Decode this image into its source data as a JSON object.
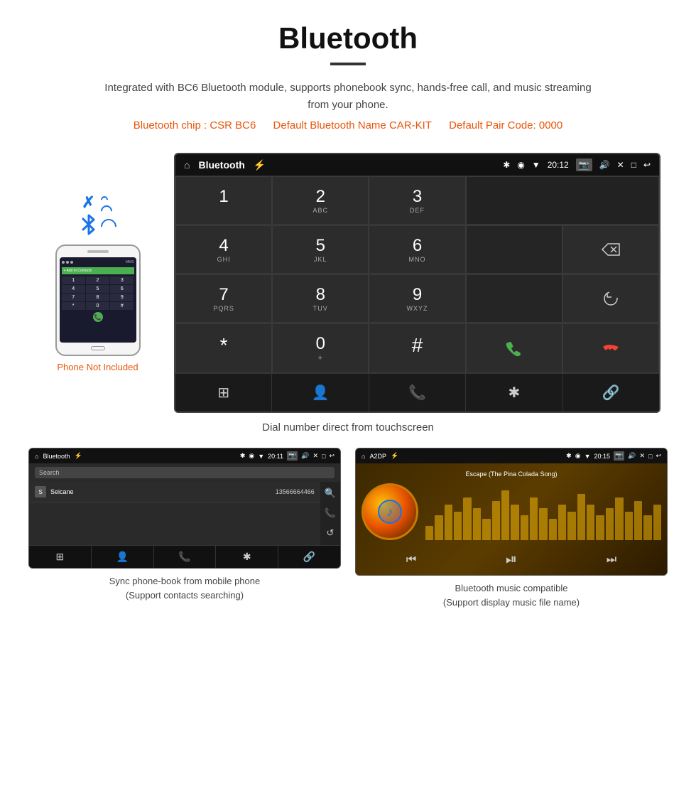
{
  "page": {
    "title": "Bluetooth",
    "subtitle": "Integrated with BC6 Bluetooth module, supports phonebook sync, hands-free call, and music streaming from your phone.",
    "spec_chip": "Bluetooth chip : CSR BC6",
    "spec_name": "Default Bluetooth Name CAR-KIT",
    "spec_code": "Default Pair Code: 0000",
    "phone_not_included": "Phone Not Included",
    "caption_main": "Dial number direct from touchscreen",
    "caption_phonebook": "Sync phone-book from mobile phone\n(Support contacts searching)",
    "caption_music": "Bluetooth music compatible\n(Support display music file name)"
  },
  "car_screen": {
    "status": {
      "home_icon": "⌂",
      "title": "Bluetooth",
      "usb_icon": "⚡",
      "bluetooth_icon": "✱",
      "location_icon": "●",
      "signal_icon": "▼",
      "time": "20:12",
      "camera_icon": "📷",
      "volume_icon": "🔊",
      "close_icon": "✕",
      "window_icon": "□",
      "back_icon": "↩"
    },
    "dialpad": {
      "keys": [
        {
          "main": "1",
          "sub": ""
        },
        {
          "main": "2",
          "sub": "ABC"
        },
        {
          "main": "3",
          "sub": "DEF"
        },
        {
          "main": "",
          "sub": "",
          "type": "display",
          "span": 2
        },
        {
          "main": "4",
          "sub": "GHI"
        },
        {
          "main": "5",
          "sub": "JKL"
        },
        {
          "main": "6",
          "sub": "MNO"
        },
        {
          "main": "⌫",
          "sub": "",
          "type": "backspace"
        },
        {
          "main": "7",
          "sub": "PQRS"
        },
        {
          "main": "8",
          "sub": "TUV"
        },
        {
          "main": "9",
          "sub": "WXYZ"
        },
        {
          "main": "↺",
          "sub": "",
          "type": "reload"
        },
        {
          "main": "*",
          "sub": ""
        },
        {
          "main": "0",
          "sub": "+"
        },
        {
          "main": "#",
          "sub": ""
        },
        {
          "main": "📞",
          "sub": "",
          "type": "call-green"
        },
        {
          "main": "📞",
          "sub": "",
          "type": "call-red"
        }
      ],
      "bottom_icons": [
        "⊞",
        "👤",
        "📞",
        "✱",
        "🔗"
      ]
    }
  },
  "phonebook_screen": {
    "status": {
      "home_icon": "⌂",
      "title": "Bluetooth",
      "usb_icon": "⚡",
      "time": "20:11"
    },
    "search_placeholder": "Search",
    "contacts": [
      {
        "letter": "S",
        "name": "Seicane",
        "number": "13566664466"
      }
    ],
    "side_icons": [
      "🔍",
      "📞",
      "↺"
    ],
    "bottom_icons": [
      "⊞",
      "👤",
      "📞",
      "✱",
      "🔗"
    ]
  },
  "music_screen": {
    "status": {
      "home_icon": "⌂",
      "title": "A2DP",
      "usb_icon": "⚡",
      "time": "20:15"
    },
    "song_title": "Escape (The Pina Colada Song)",
    "controls": [
      "⏮",
      "⏯",
      "⏭"
    ],
    "visualizer_heights": [
      20,
      35,
      50,
      40,
      60,
      45,
      30,
      55,
      70,
      50,
      35,
      60,
      45,
      30,
      50,
      40,
      65,
      50,
      35,
      45,
      60,
      40,
      55,
      35,
      50
    ]
  }
}
